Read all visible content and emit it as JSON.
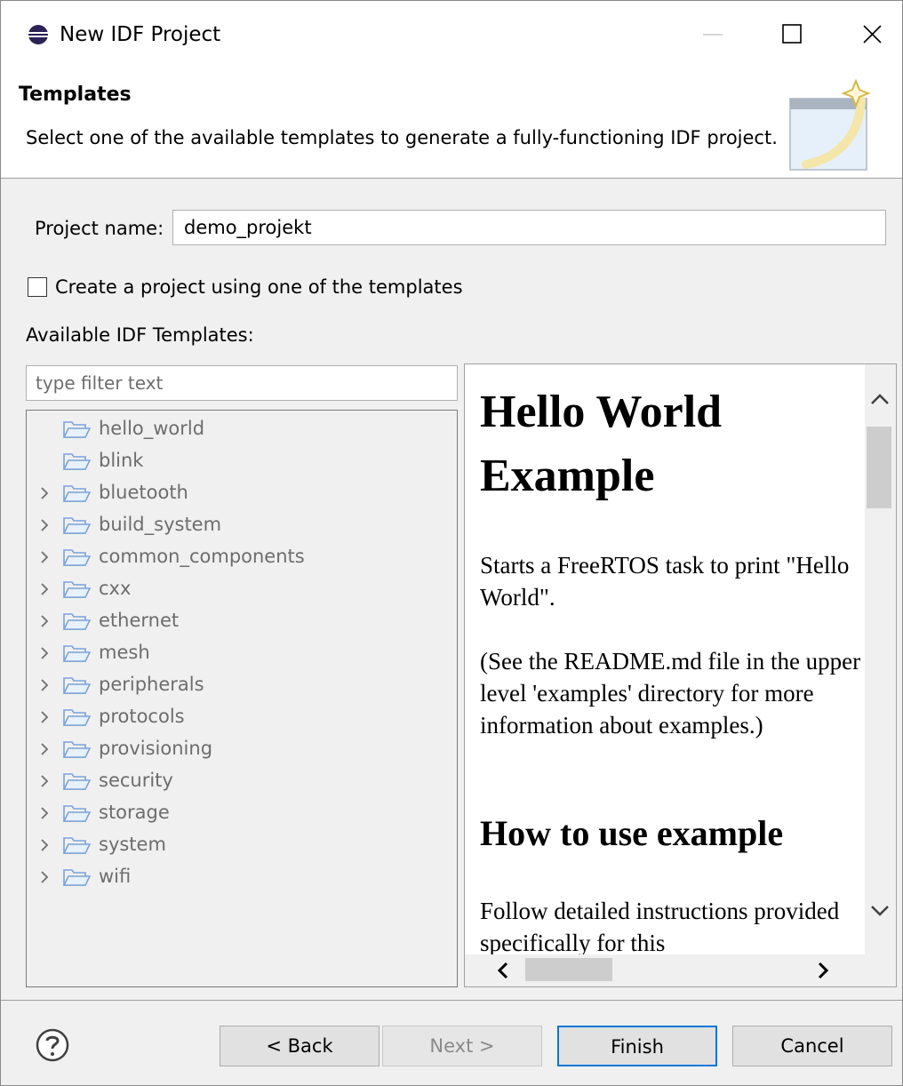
{
  "window": {
    "title": "New IDF Project",
    "app_icon": "eclipse-icon"
  },
  "banner": {
    "title": "Templates",
    "description": "Select one of the available templates to generate a fully-functioning IDF project.",
    "image": "wizard-banner-icon"
  },
  "form": {
    "project_name_label": "Project name:",
    "project_name_value": "demo_projekt",
    "template_checkbox_label": "Create a project using one of the templates",
    "template_checkbox_checked": false,
    "available_label": "Available IDF Templates:",
    "filter_placeholder": "type filter text"
  },
  "tree": {
    "items": [
      {
        "label": "hello_world",
        "expandable": false
      },
      {
        "label": "blink",
        "expandable": false
      },
      {
        "label": "bluetooth",
        "expandable": true
      },
      {
        "label": "build_system",
        "expandable": true
      },
      {
        "label": "common_components",
        "expandable": true
      },
      {
        "label": "cxx",
        "expandable": true
      },
      {
        "label": "ethernet",
        "expandable": true
      },
      {
        "label": "mesh",
        "expandable": true
      },
      {
        "label": "peripherals",
        "expandable": true
      },
      {
        "label": "protocols",
        "expandable": true
      },
      {
        "label": "provisioning",
        "expandable": true
      },
      {
        "label": "security",
        "expandable": true
      },
      {
        "label": "storage",
        "expandable": true
      },
      {
        "label": "system",
        "expandable": true
      },
      {
        "label": "wifi",
        "expandable": true
      }
    ]
  },
  "preview": {
    "heading1": "Hello World Example",
    "paragraph1": "Starts a FreeRTOS task to print \"Hello World\".",
    "paragraph2": "(See the README.md file in the upper level 'examples' directory for more information about examples.)",
    "heading2": "How to use example",
    "paragraph3": "Follow detailed instructions provided specifically for this"
  },
  "buttons": {
    "back": "< Back",
    "next": "Next >",
    "finish": "Finish",
    "cancel": "Cancel"
  },
  "colors": {
    "accent": "#0078d7",
    "folder": "#7aa3d6"
  }
}
